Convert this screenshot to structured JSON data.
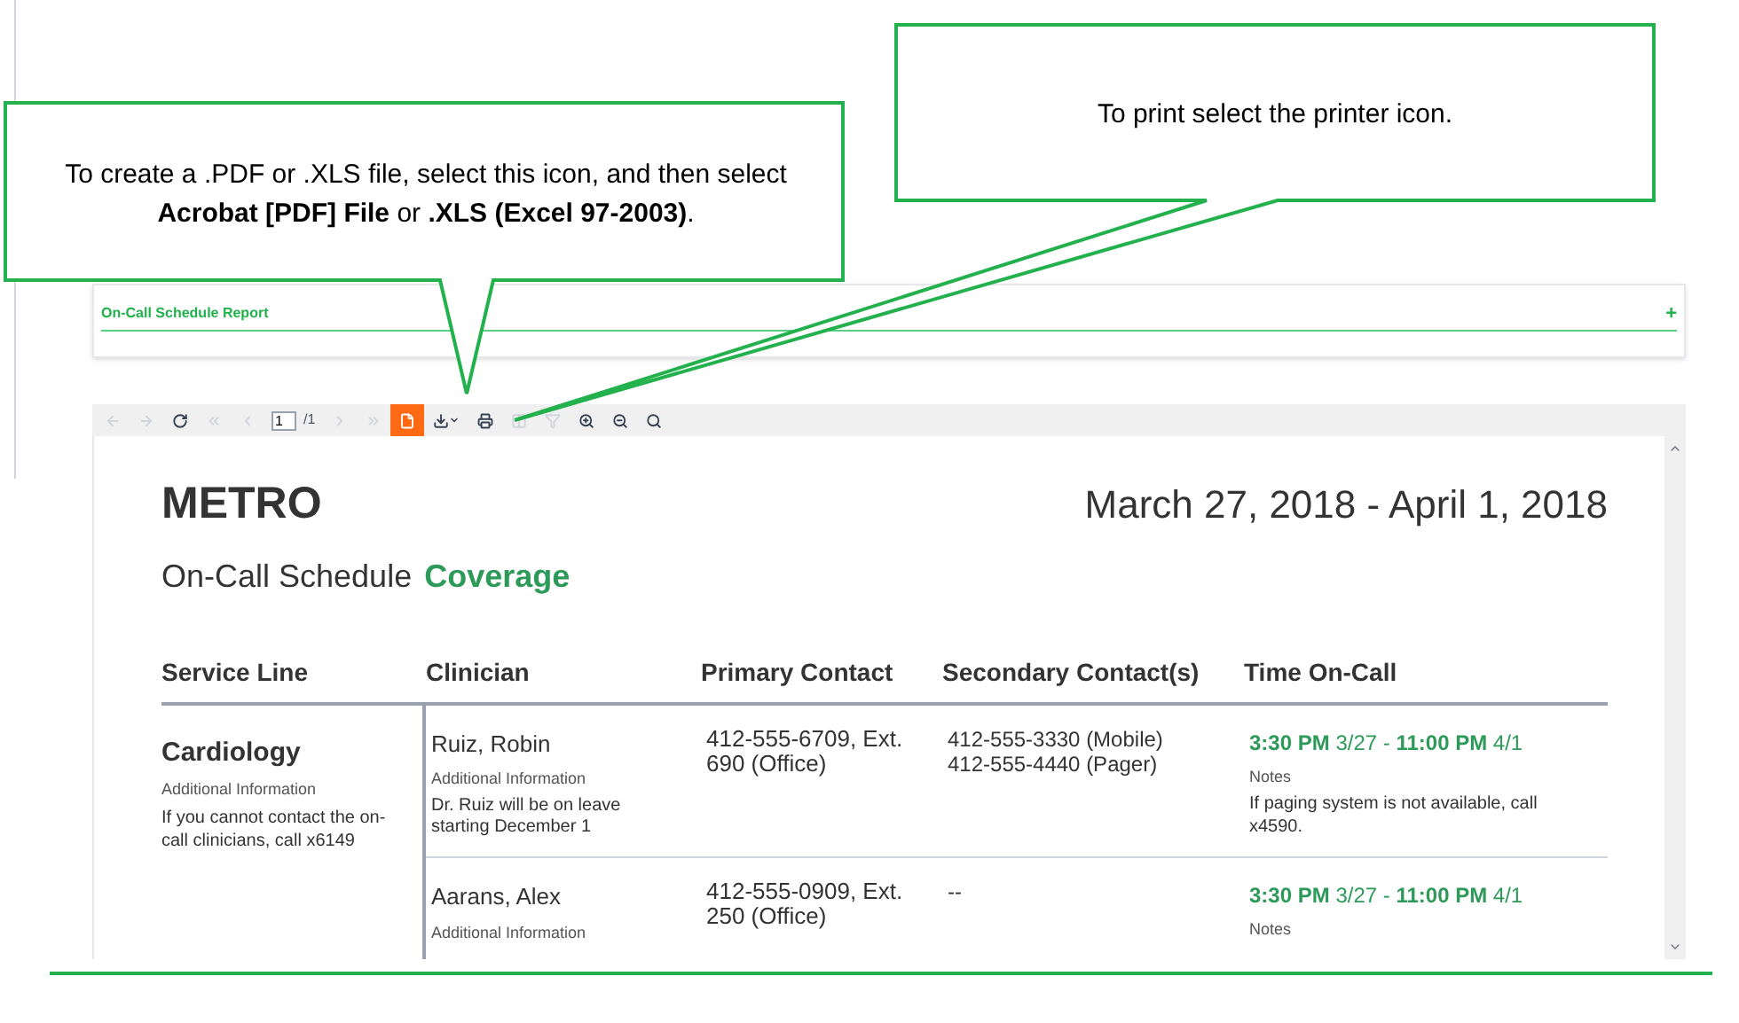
{
  "callouts": [
    {
      "text": "To create a .PDF or .XLS file, select this icon, and then select **Acrobat [PDF] File** or **.XLS (Excel 97-2003)**."
    },
    {
      "text": "To print select the printer icon."
    }
  ],
  "report_panel": {
    "title": "On-Call Schedule Report",
    "expand_symbol": "+"
  },
  "toolbar": [
    {
      "kind": "back",
      "disabled": true,
      "selected": false
    },
    {
      "kind": "forward",
      "disabled": true,
      "selected": false
    },
    {
      "kind": "refresh",
      "disabled": false,
      "selected": false
    },
    {
      "kind": "first",
      "disabled": true,
      "selected": false
    },
    {
      "kind": "prev",
      "disabled": true,
      "selected": false
    },
    {
      "kind": "page",
      "value": "1",
      "total": "/1"
    },
    {
      "kind": "next",
      "disabled": true,
      "selected": false
    },
    {
      "kind": "last",
      "disabled": true,
      "selected": false
    },
    {
      "kind": "document",
      "disabled": false,
      "selected": true
    },
    {
      "kind": "export",
      "disabled": false,
      "selected": false
    },
    {
      "kind": "print",
      "disabled": false,
      "selected": false
    },
    {
      "kind": "layout",
      "disabled": true,
      "selected": false
    },
    {
      "kind": "filter",
      "disabled": true,
      "selected": false
    },
    {
      "kind": "zoom_in",
      "disabled": false,
      "selected": false
    },
    {
      "kind": "zoom_out",
      "disabled": false,
      "selected": false
    },
    {
      "kind": "zoom",
      "disabled": false,
      "selected": false
    }
  ],
  "report": {
    "org": "METRO",
    "dates": "March 27, 2018 - April 1, 2018",
    "subtitle": "On-Call Schedule",
    "subtitle_highlight": "Coverage",
    "columns": [
      "Service Line",
      "Clinician",
      "Primary Contact",
      "Secondary Contact(s)",
      "Time On-Call"
    ],
    "groups": [
      {
        "service_line": "Cardiology",
        "info_label": "Additional Information",
        "info": "If you cannot contact the on-call clinicians, call x6149",
        "clinicians": [
          {
            "name": "Ruiz, Robin",
            "info_label": "Additional Information",
            "info": "Dr. Ruiz will be on leave starting December 1",
            "primary": "412-555-6709, Ext. 690 (Office)",
            "secondary": [
              "412-555-3330 (Mobile)",
              "412-555-4440 (Pager)"
            ],
            "time": "**3:30 PM** 3/27 - **11:00 PM** 4/1",
            "notes_label": "Notes",
            "notes": "If paging system is not available, call x4590."
          },
          {
            "name": "Aarans, Alex",
            "info_label": "Additional Information",
            "primary": "412-555-0909, Ext. 250 (Office)",
            "secondary": [
              "--"
            ],
            "time": "**3:30 PM** 3/27 - **11:00 PM** 4/1",
            "notes_label": "Notes"
          }
        ]
      }
    ]
  }
}
